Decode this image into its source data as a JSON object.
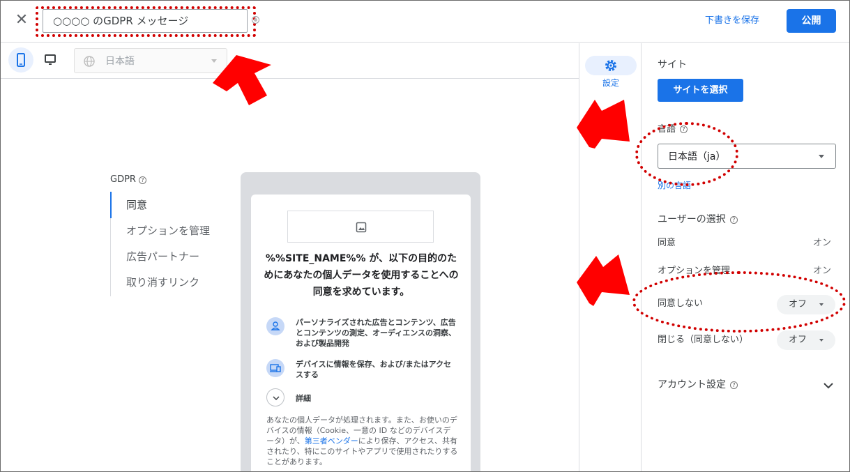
{
  "header": {
    "title_value": "○○○○ のGDPR メッセージ",
    "save_draft": "下書きを保存",
    "publish": "公開"
  },
  "toolbar": {
    "language_select": "日本語"
  },
  "nav": {
    "heading": "GDPR",
    "help_glyph": "?",
    "items": [
      "同意",
      "オプションを管理",
      "広告パートナー",
      "取り消すリンク"
    ]
  },
  "preview": {
    "headline": "%%SITE_NAME%% が、以下の目的のためにあなたの個人データを使用することへの同意を求めています。",
    "purposes": [
      "パーソナライズされた広告とコンテンツ、広告とコンテンツの測定、オーディエンスの洞察、および製品開発",
      "デバイスに情報を保存、および/またはアクセスする"
    ],
    "details_label": "詳細",
    "para_before_link": "あなたの個人データが処理されます。また、お使いのデバイスの情報（Cookie、一意の ID などのデバイスデータ）が、",
    "para_link": "第三者ベンダー",
    "para_after_link": "により保存、アクセス、共有されたり、特にこのサイトやアプリで使用されたりすることがあります。"
  },
  "rail": {
    "settings_label": "設定"
  },
  "panel": {
    "site_heading": "サイト",
    "site_button": "サイトを選択",
    "language_heading": "言語",
    "language_value": "日本語（ja）",
    "other_language_link": "別の言語",
    "user_choice_heading": "ユーザーの選択",
    "rows": [
      {
        "label": "同意",
        "value": "オン"
      },
      {
        "label": "オプションを管理",
        "value": "オン"
      },
      {
        "label": "同意しない",
        "value": "オフ"
      },
      {
        "label": "閉じる（同意しない）",
        "value": "オフ"
      }
    ],
    "account_heading": "アカウント設定"
  },
  "colors": {
    "accent": "#1a73e8",
    "annotation": "#d10000"
  }
}
